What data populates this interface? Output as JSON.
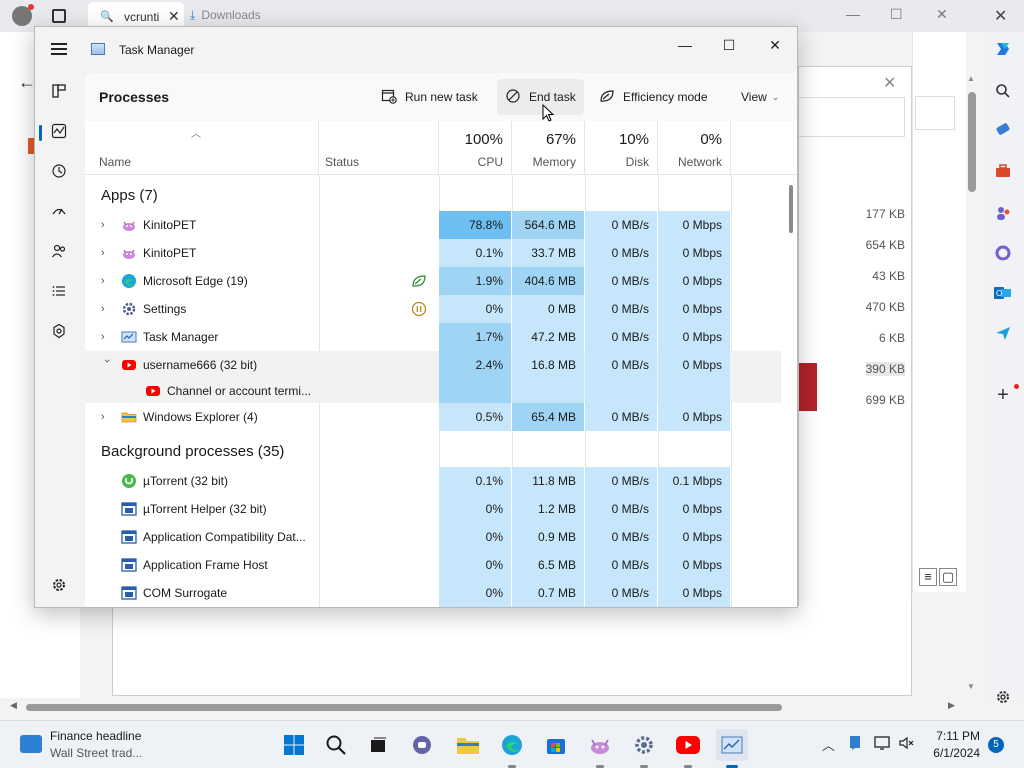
{
  "browser": {
    "tab1_title": "vcrunti",
    "tab2_title": "Downloads",
    "downloads_sizes": [
      "177 KB",
      "654 KB",
      "43 KB",
      "470 KB",
      "6 KB",
      "390 KB",
      "699 KB"
    ]
  },
  "window": {
    "title": "Task Manager",
    "minimize": "—",
    "maximize": "☐",
    "close": "✕"
  },
  "toolbar": {
    "page_title": "Processes",
    "run_new_task": "Run new task",
    "end_task": "End task",
    "efficiency_mode": "Efficiency mode",
    "view": "View"
  },
  "columns": {
    "name": "Name",
    "status": "Status",
    "cpu_pct": "100%",
    "cpu": "CPU",
    "memory_pct": "67%",
    "memory": "Memory",
    "disk_pct": "10%",
    "disk": "Disk",
    "network_pct": "0%",
    "network": "Network"
  },
  "groups": {
    "apps": "Apps (7)",
    "background": "Background processes (35)"
  },
  "apps": [
    {
      "name": "KinitoPET",
      "cpu": "78.8%",
      "memory": "564.6 MB",
      "disk": "0 MB/s",
      "network": "0 Mbps"
    },
    {
      "name": "KinitoPET",
      "cpu": "0.1%",
      "memory": "33.7 MB",
      "disk": "0 MB/s",
      "network": "0 Mbps"
    },
    {
      "name": "Microsoft Edge (19)",
      "cpu": "1.9%",
      "memory": "404.6 MB",
      "disk": "0 MB/s",
      "network": "0 Mbps"
    },
    {
      "name": "Settings",
      "cpu": "0%",
      "memory": "0 MB",
      "disk": "0 MB/s",
      "network": "0 Mbps"
    },
    {
      "name": "Task Manager",
      "cpu": "1.7%",
      "memory": "47.2 MB",
      "disk": "0 MB/s",
      "network": "0 Mbps"
    },
    {
      "name": "username666 (32 bit)",
      "cpu": "2.4%",
      "memory": "16.8 MB",
      "disk": "0 MB/s",
      "network": "0 Mbps"
    },
    {
      "name": "Channel or account termi..."
    },
    {
      "name": "Windows Explorer (4)",
      "cpu": "0.5%",
      "memory": "65.4 MB",
      "disk": "0 MB/s",
      "network": "0 Mbps"
    }
  ],
  "background": [
    {
      "name": "µTorrent (32 bit)",
      "cpu": "0.1%",
      "memory": "11.8 MB",
      "disk": "0 MB/s",
      "network": "0.1 Mbps"
    },
    {
      "name": "µTorrent Helper (32 bit)",
      "cpu": "0%",
      "memory": "1.2 MB",
      "disk": "0 MB/s",
      "network": "0 Mbps"
    },
    {
      "name": "Application Compatibility Dat...",
      "cpu": "0%",
      "memory": "0.9 MB",
      "disk": "0 MB/s",
      "network": "0 Mbps"
    },
    {
      "name": "Application Frame Host",
      "cpu": "0%",
      "memory": "6.5 MB",
      "disk": "0 MB/s",
      "network": "0 Mbps"
    },
    {
      "name": "COM Surrogate",
      "cpu": "0%",
      "memory": "0.7 MB",
      "disk": "0 MB/s",
      "network": "0 Mbps"
    }
  ],
  "taskbar": {
    "news_title": "Finance headline",
    "news_sub": "Wall Street trad...",
    "time": "7:11 PM",
    "date": "6/1/2024",
    "notifications": "5"
  }
}
